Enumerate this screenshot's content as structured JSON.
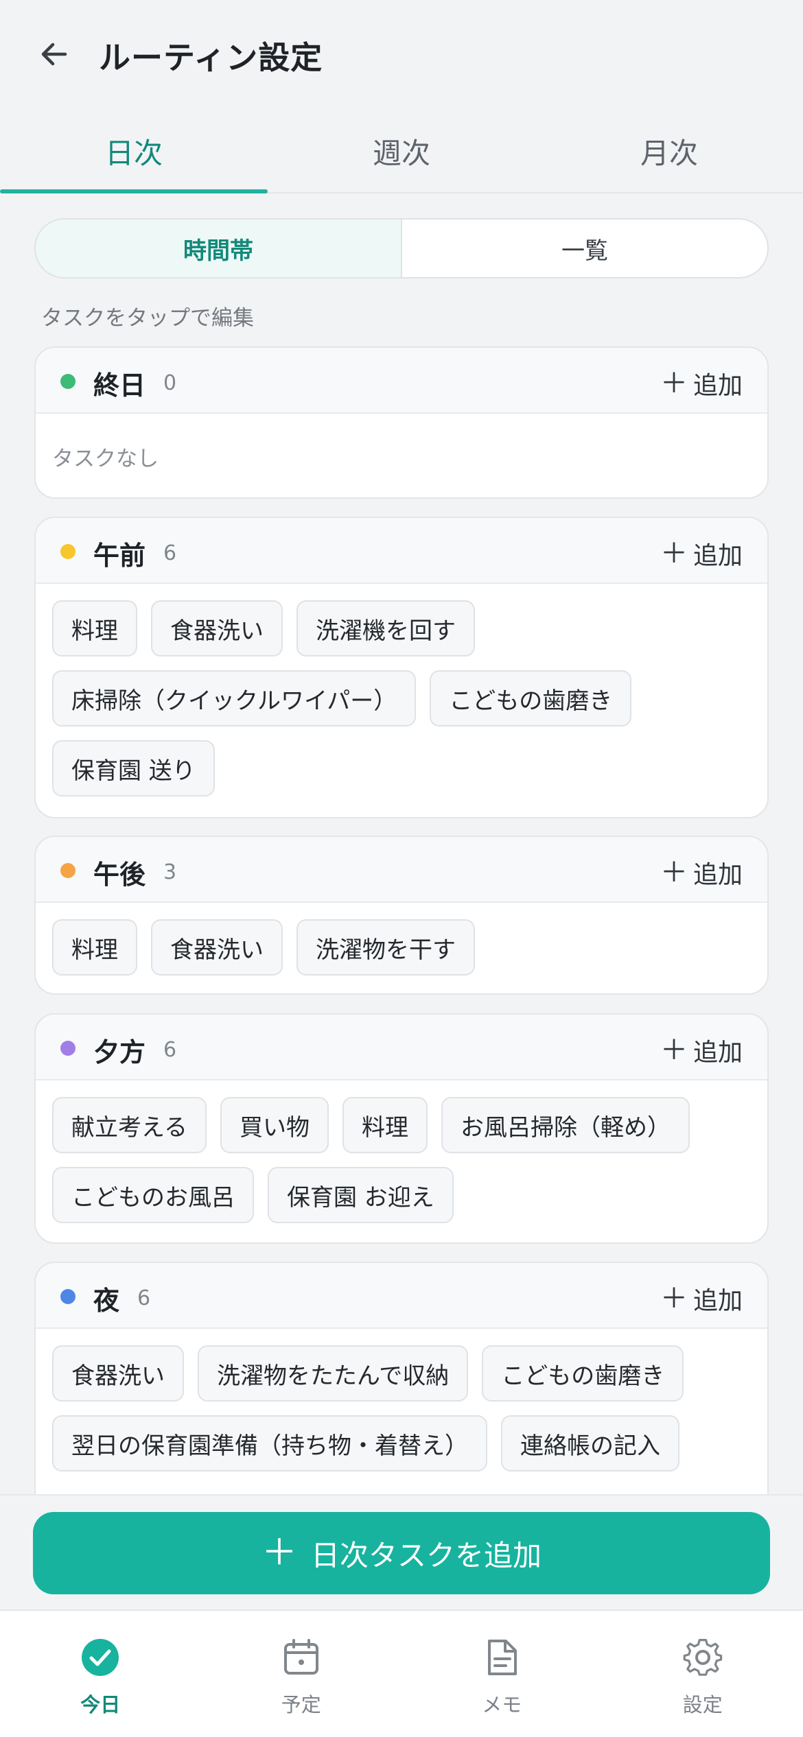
{
  "header": {
    "title": "ルーティン設定"
  },
  "tabs": [
    {
      "label": "日次",
      "active": true
    },
    {
      "label": "週次",
      "active": false
    },
    {
      "label": "月次",
      "active": false
    }
  ],
  "segment": [
    {
      "label": "時間帯",
      "active": true
    },
    {
      "label": "一覧",
      "active": false
    }
  ],
  "hint": "タスクをタップで編集",
  "add_label": "追加",
  "empty_label": "タスクなし",
  "periods": [
    {
      "name": "終日",
      "count": "0",
      "color": "#3dbb77",
      "tasks": []
    },
    {
      "name": "午前",
      "count": "6",
      "color": "#f7c52e",
      "tasks": [
        "料理",
        "食器洗い",
        "洗濯機を回す",
        "床掃除（クイックルワイパー）",
        "こどもの歯磨き",
        "保育園 送り"
      ]
    },
    {
      "name": "午後",
      "count": "3",
      "color": "#f5a445",
      "tasks": [
        "料理",
        "食器洗い",
        "洗濯物を干す"
      ]
    },
    {
      "name": "夕方",
      "count": "6",
      "color": "#a07ee6",
      "tasks": [
        "献立考える",
        "買い物",
        "料理",
        "お風呂掃除（軽め）",
        "こどものお風呂",
        "保育園 お迎え"
      ]
    },
    {
      "name": "夜",
      "count": "6",
      "color": "#4f86e6",
      "tasks": [
        "食器洗い",
        "洗濯物をたたんで収納",
        "こどもの歯磨き",
        "翌日の保育園準備（持ち物・着替え）",
        "連絡帳の記入"
      ]
    }
  ],
  "fab": {
    "label": "日次タスクを追加"
  },
  "nav": [
    {
      "label": "今日",
      "icon": "check-circle-icon",
      "active": true
    },
    {
      "label": "予定",
      "icon": "calendar-icon",
      "active": false
    },
    {
      "label": "メモ",
      "icon": "document-icon",
      "active": false
    },
    {
      "label": "設定",
      "icon": "gear-icon",
      "active": false
    }
  ],
  "colors": {
    "accent": "#17b39e",
    "accent_text": "#12897a"
  }
}
